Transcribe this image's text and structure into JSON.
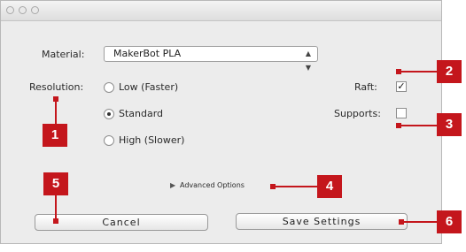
{
  "dialog": {
    "material_label": "Material:",
    "material_value": "MakerBot PLA",
    "resolution_label": "Resolution:",
    "resolution_options": [
      {
        "label": "Low (Faster)",
        "selected": false
      },
      {
        "label": "Standard",
        "selected": true
      },
      {
        "label": "High (Slower)",
        "selected": false
      }
    ],
    "raft_label": "Raft:",
    "raft_checked": true,
    "raft_mark": "✓",
    "supports_label": "Supports:",
    "supports_checked": false,
    "advanced_options": "Advanced Options",
    "disclosure_glyph": "▶",
    "cancel_label": "Cancel",
    "save_label": "Save Settings"
  },
  "callouts": [
    "1",
    "2",
    "3",
    "4",
    "5",
    "6"
  ],
  "colors": {
    "callout": "#c4161c",
    "window_bg": "#ececec"
  }
}
